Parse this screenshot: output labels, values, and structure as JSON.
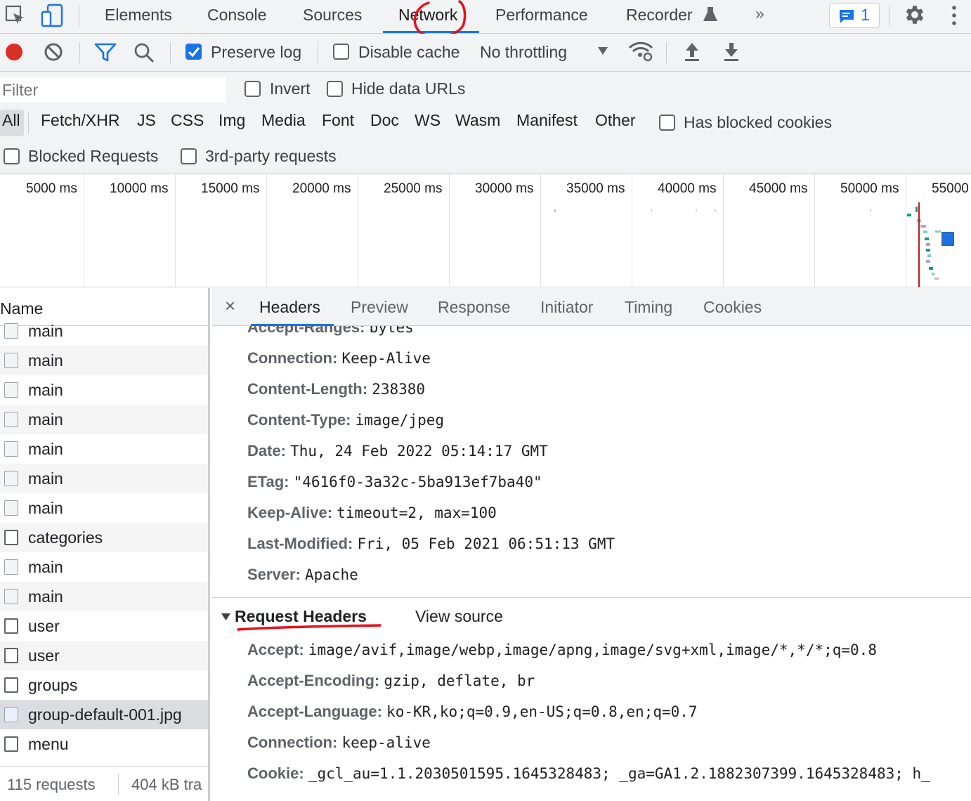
{
  "toptabs": [
    "Elements",
    "Console",
    "Sources",
    "Network",
    "Performance",
    "Recorder"
  ],
  "more_tabs_glyph": "»",
  "issues_count": "1",
  "toolbar": {
    "preserve_log": "Preserve log",
    "disable_cache": "Disable cache",
    "throttling": "No throttling"
  },
  "filter": {
    "placeholder": "Filter",
    "invert": "Invert",
    "hide_data_urls": "Hide data URLs",
    "types": [
      "All",
      "Fetch/XHR",
      "JS",
      "CSS",
      "Img",
      "Media",
      "Font",
      "Doc",
      "WS",
      "Wasm",
      "Manifest",
      "Other"
    ],
    "has_blocked_cookies": "Has blocked cookies",
    "blocked_requests": "Blocked Requests",
    "third_party": "3rd-party requests"
  },
  "overview": {
    "ticks": [
      "5000 ms",
      "10000 ms",
      "15000 ms",
      "20000 ms",
      "25000 ms",
      "30000 ms",
      "35000 ms",
      "40000 ms",
      "45000 ms",
      "50000 ms",
      "55000"
    ]
  },
  "requests": {
    "header": "Name",
    "rows": [
      {
        "name": "main",
        "icon": "generic"
      },
      {
        "name": "main",
        "icon": "generic"
      },
      {
        "name": "main",
        "icon": "generic"
      },
      {
        "name": "main",
        "icon": "generic"
      },
      {
        "name": "main",
        "icon": "generic"
      },
      {
        "name": "main",
        "icon": "generic"
      },
      {
        "name": "main",
        "icon": "generic"
      },
      {
        "name": "categories",
        "icon": "doc"
      },
      {
        "name": "main",
        "icon": "generic"
      },
      {
        "name": "main",
        "icon": "generic"
      },
      {
        "name": "user",
        "icon": "doc"
      },
      {
        "name": "user",
        "icon": "doc"
      },
      {
        "name": "groups",
        "icon": "doc"
      },
      {
        "name": "group-default-001.jpg",
        "icon": "image"
      },
      {
        "name": "menu",
        "icon": "doc"
      }
    ],
    "status_count": "115 requests",
    "status_size": "404 kB tra"
  },
  "detail": {
    "close_glyph": "×",
    "tabs": [
      "Headers",
      "Preview",
      "Response",
      "Initiator",
      "Timing",
      "Cookies"
    ],
    "response_headers": [
      {
        "key": "Accept-Ranges:",
        "value": "bytes"
      },
      {
        "key": "Connection:",
        "value": "Keep-Alive"
      },
      {
        "key": "Content-Length:",
        "value": "238380"
      },
      {
        "key": "Content-Type:",
        "value": "image/jpeg"
      },
      {
        "key": "Date:",
        "value": "Thu, 24 Feb 2022 05:14:17 GMT"
      },
      {
        "key": "ETag:",
        "value": "\"4616f0-3a32c-5ba913ef7ba40\""
      },
      {
        "key": "Keep-Alive:",
        "value": "timeout=2, max=100"
      },
      {
        "key": "Last-Modified:",
        "value": "Fri, 05 Feb 2021 06:51:13 GMT"
      },
      {
        "key": "Server:",
        "value": "Apache"
      }
    ],
    "request_section": "Request Headers",
    "view_source": "View source",
    "request_headers": [
      {
        "key": "Accept:",
        "value": "image/avif,image/webp,image/apng,image/svg+xml,image/*,*/*;q=0.8"
      },
      {
        "key": "Accept-Encoding:",
        "value": "gzip, deflate, br"
      },
      {
        "key": "Accept-Language:",
        "value": "ko-KR,ko;q=0.9,en-US;q=0.8,en;q=0.7"
      },
      {
        "key": "Connection:",
        "value": "keep-alive"
      },
      {
        "key": "Cookie:",
        "value": "_gcl_au=1.1.2030501595.1645328483; _ga=GA1.2.1882307399.1645328483; h_"
      }
    ]
  },
  "colors": {
    "accent": "#1a73e8",
    "record": "#d93025",
    "annotation": "#e8101a",
    "panel": "#f1f3f4"
  }
}
